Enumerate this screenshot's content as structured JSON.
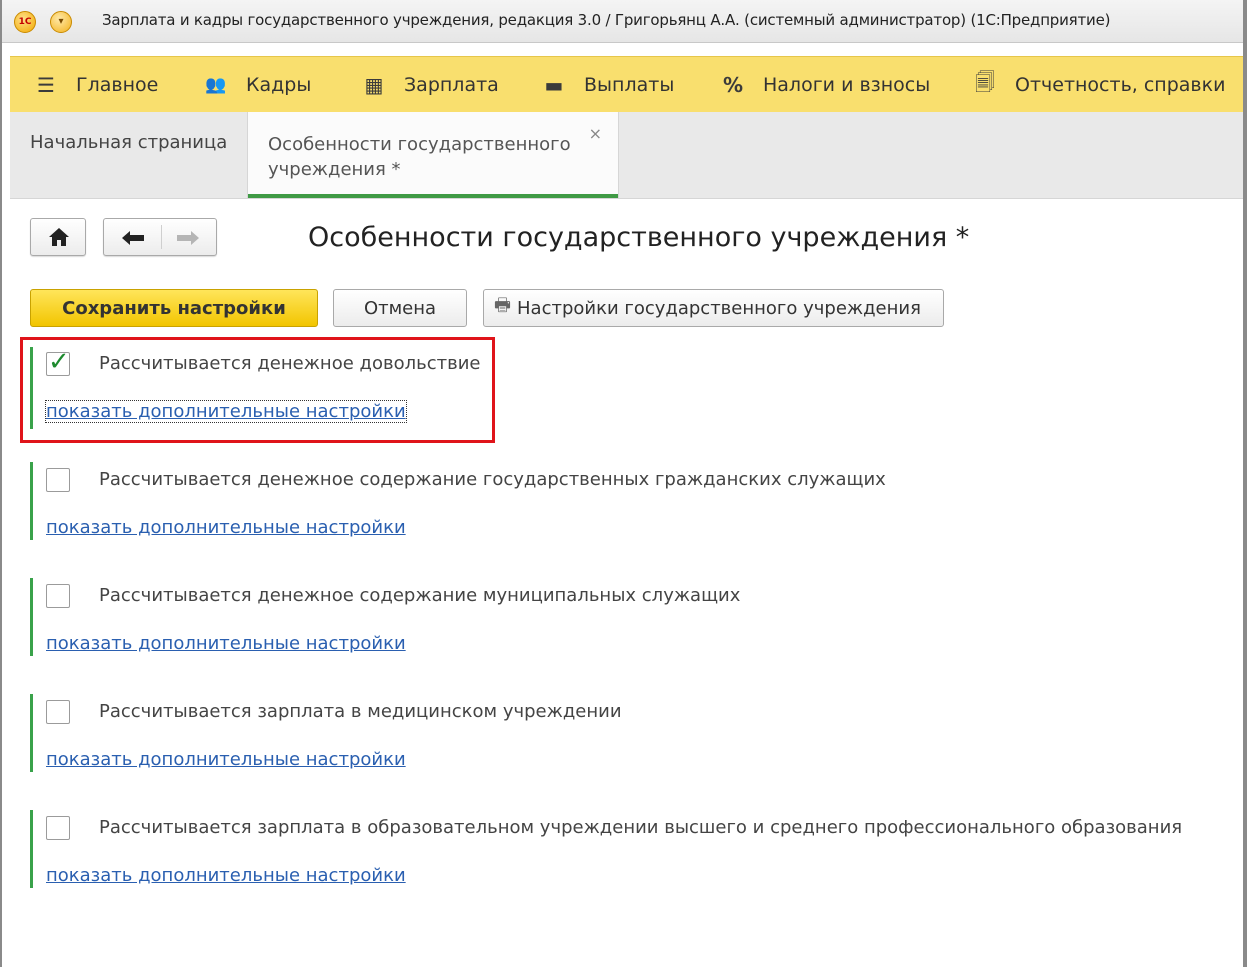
{
  "window": {
    "title": "Зарплата и кадры государственного учреждения, редакция 3.0 / Григорьянц А.А. (системный администратор)  (1С:Предприятие)",
    "logo_text": "1С"
  },
  "sections": [
    {
      "label": "Главное",
      "icon": "hamburger-icon",
      "glyph": "☰"
    },
    {
      "label": "Кадры",
      "icon": "people-icon",
      "glyph": "👥"
    },
    {
      "label": "Зарплата",
      "icon": "calculator-icon",
      "glyph": "▦"
    },
    {
      "label": "Выплаты",
      "icon": "wallet-icon",
      "glyph": "▬"
    },
    {
      "label": "Налоги и взносы",
      "icon": "percent-icon",
      "glyph": "%"
    },
    {
      "label": "Отчетность, справки",
      "icon": "documents-icon",
      "glyph": "🗐"
    }
  ],
  "tabs": {
    "home": "Начальная страница",
    "active": "Особенности государственного учреждения *",
    "close_glyph": "×"
  },
  "page": {
    "title": "Особенности государственного учреждения *"
  },
  "buttons": {
    "save": "Сохранить настройки",
    "cancel": "Отмена",
    "settings": "Настройки государственного учреждения"
  },
  "groups": [
    {
      "label": "Рассчитывается денежное довольствие",
      "checked": true,
      "link": "показать дополнительные настройки"
    },
    {
      "label": "Рассчитывается денежное содержание государственных гражданских служащих",
      "checked": false,
      "link": "показать дополнительные настройки"
    },
    {
      "label": "Рассчитывается денежное содержание муниципальных служащих",
      "checked": false,
      "link": "показать дополнительные настройки"
    },
    {
      "label": "Рассчитывается зарплата в медицинском учреждении",
      "checked": false,
      "link": "показать дополнительные настройки"
    },
    {
      "label": "Рассчитывается зарплата в образовательном учреждении высшего и среднего профессионального образования",
      "checked": false,
      "link": "показать дополнительные настройки"
    }
  ],
  "colors": {
    "section_bg": "#f9df6e",
    "save_button": "#f2c500",
    "accent_green": "#39a24a",
    "link": "#2a5fb0",
    "highlight": "#e0141a"
  }
}
